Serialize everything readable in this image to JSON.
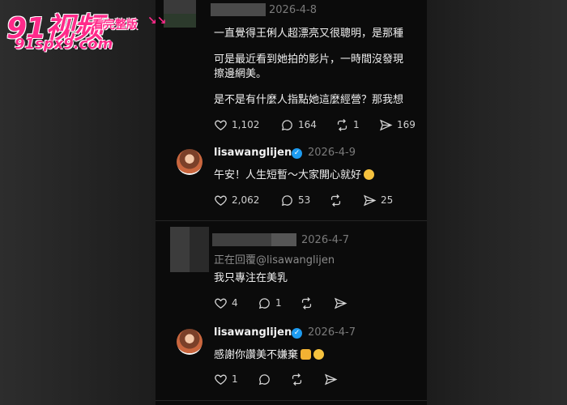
{
  "watermark": {
    "brand": "91视频",
    "tag": "看完整版",
    "arrows": "↘↘",
    "url": "91spx9.com"
  },
  "post1": {
    "date": "2026-4-8",
    "lines": [
      "一直覺得王俐人超漂亮又很聰明，是那種",
      "可是最近看到她拍的影片，一時間沒發現",
      "擦邊網美。",
      "是不是有什麼人指點她這麼經營？那我想"
    ],
    "likes": "1,102",
    "comments": "164",
    "reposts": "1",
    "shares": "169"
  },
  "reply1": {
    "username": "lisawanglijen",
    "date": "2026-4-9",
    "text": "午安！人生短暫～大家開心就好",
    "likes": "2,062",
    "comments": "53",
    "shares": "25"
  },
  "post2": {
    "date": "2026-4-7",
    "replying_to": "正在回覆@lisawanglijen",
    "text": "我只專注在美乳",
    "likes": "4",
    "comments": "1"
  },
  "reply2": {
    "username": "lisawanglijen",
    "date": "2026-4-7",
    "text": "感謝你讚美不嫌棄",
    "likes": "1"
  },
  "icons": {
    "like": "heart-icon",
    "comment": "comment-icon",
    "repost": "repost-icon",
    "share": "send-icon",
    "verified": "verified-badge-icon"
  },
  "colors": {
    "panel": "#0b0b0b",
    "verified": "#1d9bf0",
    "watermark": "#ff2a8a"
  }
}
